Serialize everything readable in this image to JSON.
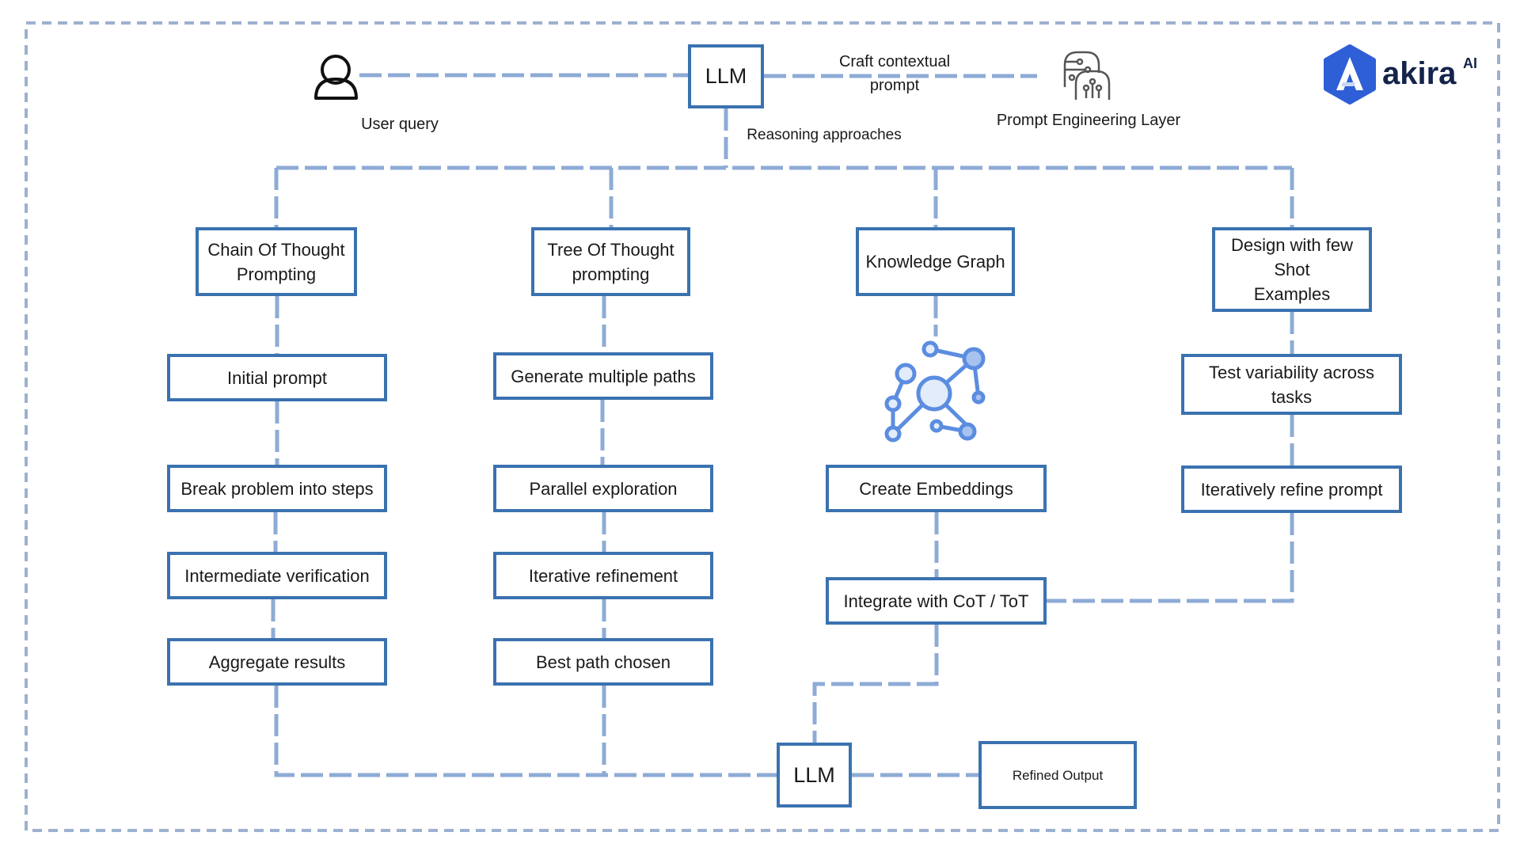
{
  "diagram": {
    "top": {
      "user_label": "User query",
      "llm_label": "LLM",
      "craft_label": "Craft contextual\nprompt",
      "reasoning_label": "Reasoning  approaches",
      "prompt_layer_label": "Prompt Engineering Layer"
    },
    "brand": {
      "name": "akira",
      "suffix": "AI",
      "color": "#2f5fd6",
      "text_color": "#14234a"
    },
    "colors": {
      "box_border": "#3a72b0",
      "connector": "#8eabd6",
      "frame": "#9db1d0",
      "graph_icon": "#5b8de0"
    },
    "columns": [
      {
        "header": "Chain Of Thought\nPrompting",
        "steps": [
          "Initial prompt",
          "Break problem into steps",
          "Intermediate verification",
          "Aggregate results"
        ]
      },
      {
        "header": "Tree Of Thought\nprompting",
        "steps": [
          "Generate multiple paths",
          "Parallel exploration",
          "Iterative refinement",
          "Best path chosen"
        ]
      },
      {
        "header": "Knowledge Graph",
        "steps": [
          "Create Embeddings",
          "Integrate with CoT / ToT"
        ]
      },
      {
        "header": "Design with few\nShot\nExamples",
        "steps": [
          "Test variability across\ntasks",
          "Iteratively refine prompt"
        ]
      }
    ],
    "bottom": {
      "llm_label": "LLM",
      "output_label": "Refined Output"
    }
  }
}
